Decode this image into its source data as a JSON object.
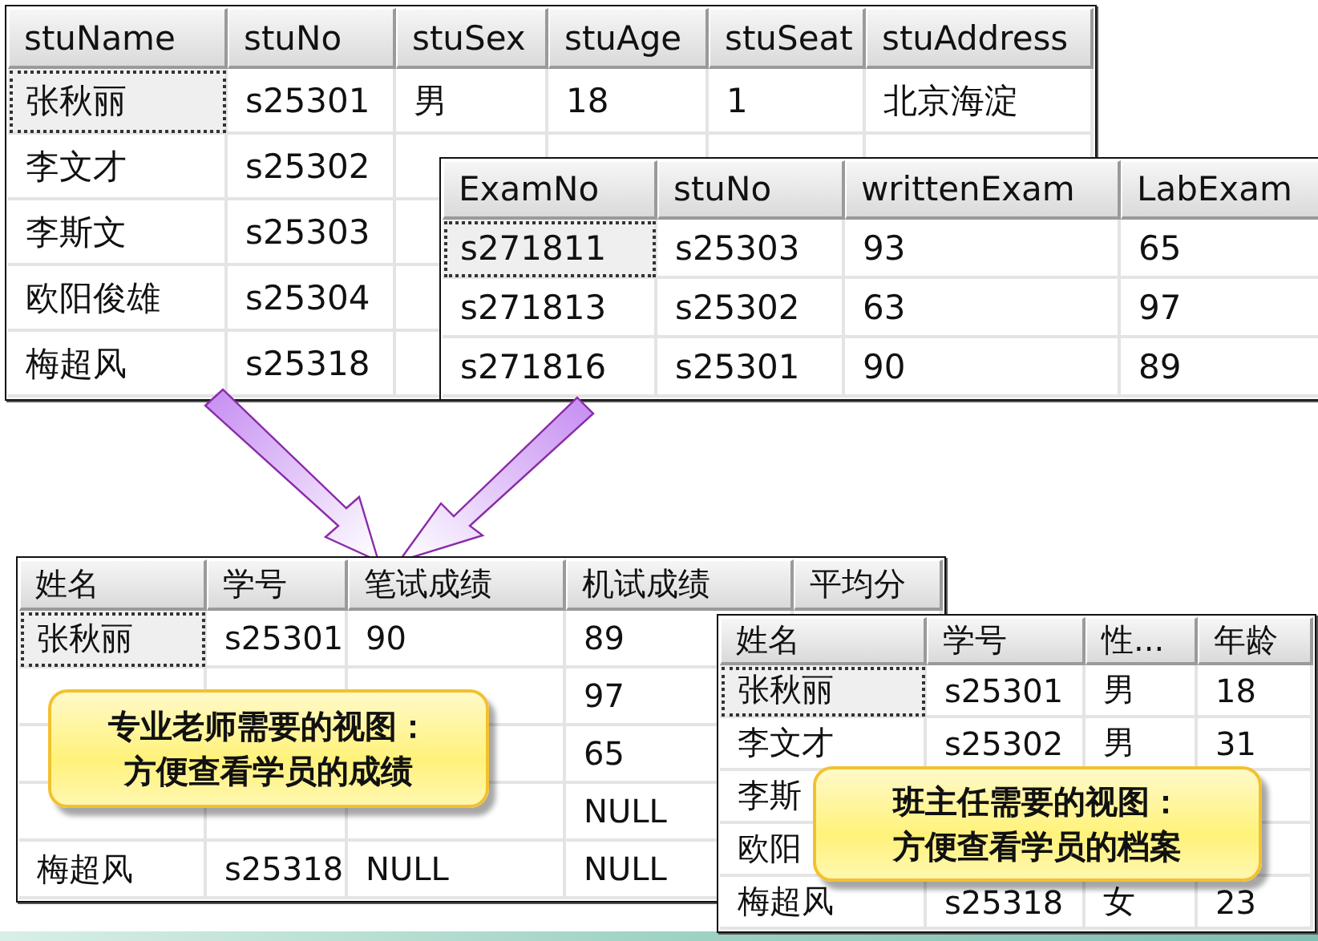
{
  "grids": [
    {
      "columns": [
        "stuName",
        "stuNo",
        "stuSex",
        "stuAge",
        "stuSeat",
        "stuAddress"
      ],
      "rows": [
        {
          "selected": true,
          "cells": {
            "col_1": "张秋丽",
            "col_2": "s25301",
            "col_3": "男",
            "col_4": "18",
            "col_5": "1",
            "col_6": "北京海淀"
          }
        },
        {
          "selected": false,
          "cells": {
            "col_1": "李文才",
            "col_2": "s25302"
          }
        },
        {
          "selected": false,
          "cells": {
            "col_1": "李斯文",
            "col_2": "s25303"
          }
        },
        {
          "selected": false,
          "cells": {
            "col_1": "欧阳俊雄",
            "col_2": "s25304"
          }
        },
        {
          "selected": false,
          "cells": {
            "col_1": "梅超风",
            "col_2": "s25318"
          }
        }
      ]
    },
    {
      "columns": [
        "ExamNo",
        "stuNo",
        "writtenExam",
        "LabExam"
      ],
      "rows": [
        {
          "selected": true,
          "cells": {
            "col_1": "s271811",
            "col_2": "s25303",
            "col_3": "93",
            "col_4": "65"
          }
        },
        {
          "selected": false,
          "cells": {
            "col_1": "s271813",
            "col_2": "s25302",
            "col_3": "63",
            "col_4": "97"
          }
        },
        {
          "selected": false,
          "cells": {
            "col_1": "s271816",
            "col_2": "s25301",
            "col_3": "90",
            "col_4": "89"
          }
        }
      ]
    },
    {
      "columns": [
        "姓名",
        "学号",
        "笔试成绩",
        "机试成绩",
        "平均分"
      ],
      "rows": [
        {
          "selected": true,
          "cells": {
            "col_1": "张秋丽",
            "col_2": "s25301",
            "col_3": "90",
            "col_4": "89"
          }
        },
        {
          "selected": false,
          "cells": {
            "col_4": "97"
          }
        },
        {
          "selected": false,
          "cells": {
            "col_4": "65"
          }
        },
        {
          "selected": false,
          "cells": {
            "col_4": "NULL"
          }
        },
        {
          "selected": false,
          "cells": {
            "col_1": "梅超风",
            "col_2": "s25318",
            "col_3": "NULL",
            "col_4": "NULL"
          }
        }
      ]
    },
    {
      "columns": [
        "姓名",
        "学号",
        "性...",
        "年龄"
      ],
      "rows": [
        {
          "selected": true,
          "cells": {
            "col_1": "张秋丽",
            "col_2": "s25301",
            "col_3": "男",
            "col_4": "18"
          }
        },
        {
          "selected": false,
          "cells": {
            "col_1": "李文才",
            "col_2": "s25302",
            "col_3": "男",
            "col_4": "31"
          }
        },
        {
          "selected": false,
          "cells": {
            "col_1": "李斯"
          }
        },
        {
          "selected": false,
          "cells": {
            "col_1": "欧阳"
          }
        },
        {
          "selected": false,
          "cells": {
            "col_1": "梅超风",
            "col_2": "s25318",
            "col_3": "女",
            "col_4": "23"
          }
        }
      ]
    }
  ],
  "callouts": [
    {
      "lines": [
        "专业老师需要的视图：",
        "方便查看学员的成绩"
      ]
    },
    {
      "lines": [
        "班主任需要的视图：",
        "方便查看学员的档案"
      ]
    }
  ]
}
